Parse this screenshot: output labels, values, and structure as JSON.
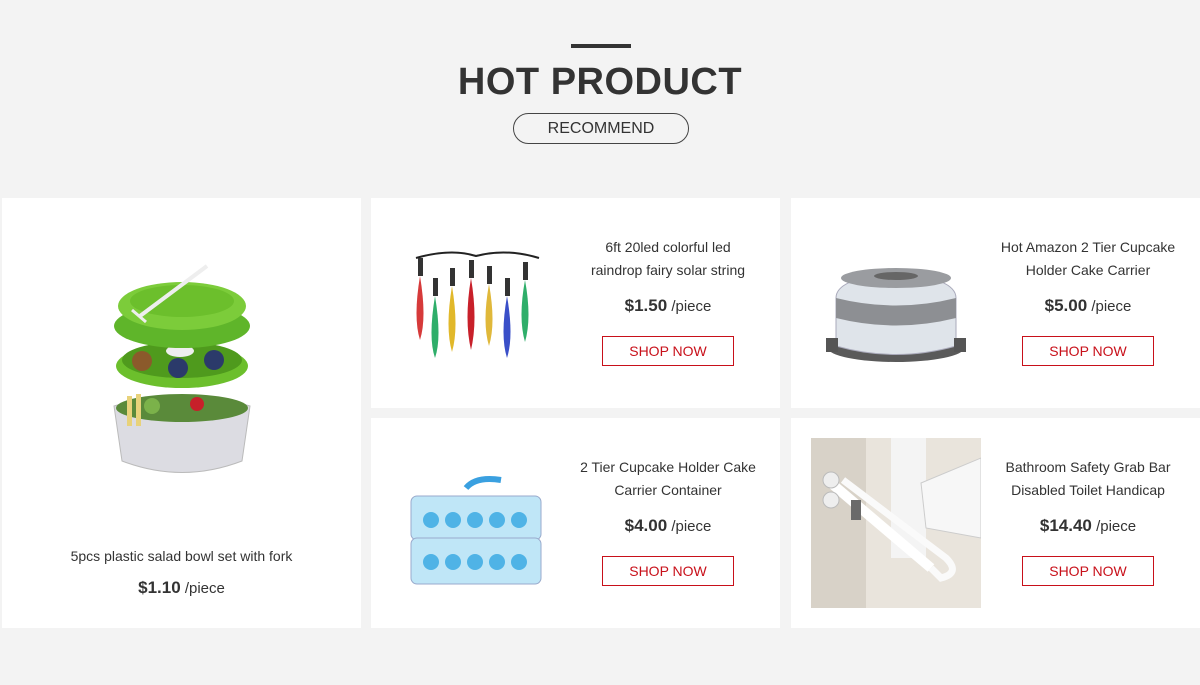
{
  "header": {
    "title": "HOT PRODUCT",
    "subtitle_pill": "RECOMMEND"
  },
  "featured": {
    "title": "5pcs plastic salad bowl set with fork",
    "price": "$1.10",
    "unit": "/piece",
    "image_icon": "salad-bowl-image"
  },
  "products": [
    {
      "title_line1": "6ft 20led colorful led",
      "title_line2": "raindrop fairy solar string",
      "price": "$1.50",
      "unit": "/piece",
      "button": "SHOP NOW",
      "image_icon": "fairy-lights-image"
    },
    {
      "title_line1": "Hot Amazon 2 Tier Cupcake",
      "title_line2": "Holder Cake Carrier",
      "price": "$5.00",
      "unit": "/piece",
      "button": "SHOP NOW",
      "image_icon": "cake-carrier-image"
    },
    {
      "title_line1": "2 Tier Cupcake Holder Cake",
      "title_line2": "Carrier Container",
      "price": "$4.00",
      "unit": "/piece",
      "button": "SHOP NOW",
      "image_icon": "cupcake-container-image"
    },
    {
      "title_line1": "Bathroom Safety Grab Bar",
      "title_line2": "Disabled Toilet Handicap",
      "price": "$14.40",
      "unit": "/piece",
      "button": "SHOP NOW",
      "image_icon": "grab-bar-image"
    }
  ],
  "colors": {
    "background": "#f3f3f3",
    "card": "#ffffff",
    "accent_red": "#c8101a",
    "text": "#333333"
  }
}
